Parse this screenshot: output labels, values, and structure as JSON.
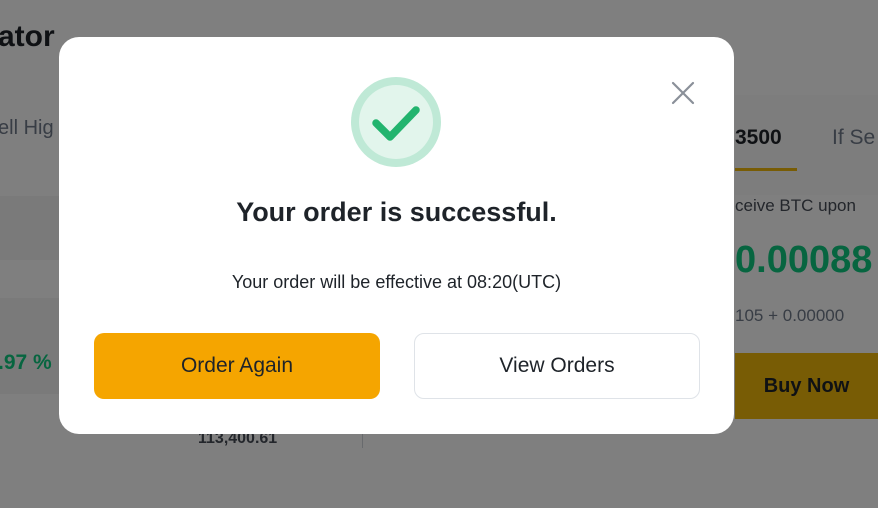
{
  "background": {
    "title_fragment": "ator",
    "left_tab_fragment": "ell Hig",
    "change_percent_fragment": ".97 %",
    "price_value": "113,400.61",
    "active_tab_fragment": "3500",
    "inactive_tab_fragment": "If Se",
    "receive_text_fragment": "ceive BTC upon",
    "amount_fragment": "0.00088",
    "calc_fragment": "105 + 0.00000",
    "buy_button_label": "Buy Now"
  },
  "modal": {
    "icon": "check-circle-icon",
    "close_icon": "close-icon",
    "title": "Your order is successful.",
    "message": "Your order will be effective at 08:20(UTC)",
    "primary_button": "Order Again",
    "secondary_button": "View Orders"
  },
  "colors": {
    "accent": "#f5a500",
    "success": "#0ecb81",
    "overlay": "rgba(0,0,0,0.5)"
  }
}
